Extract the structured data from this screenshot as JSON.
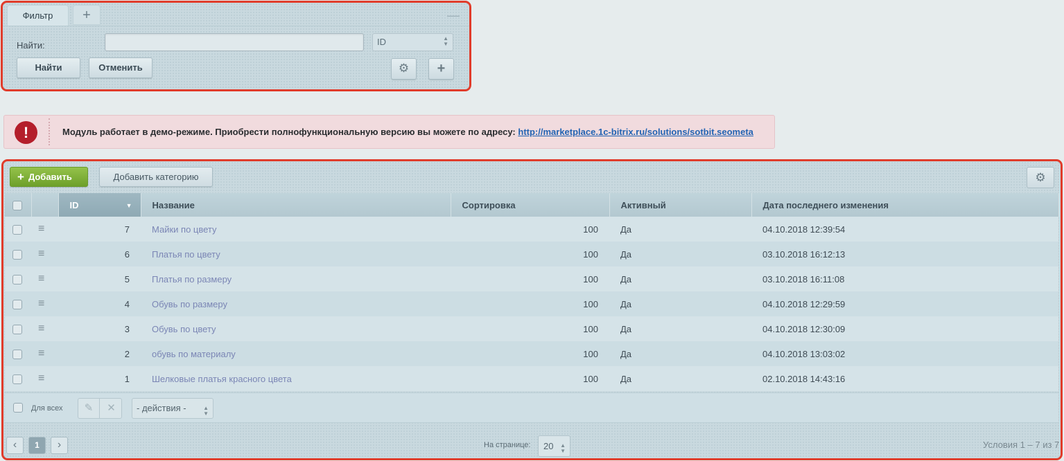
{
  "filter": {
    "tab_label": "Фильтр",
    "add_tab_icon": "plus-icon",
    "find_label": "Найти:",
    "search_value": "",
    "field_select": "ID",
    "find_button": "Найти",
    "cancel_button": "Отменить"
  },
  "notice": {
    "icon": "!",
    "text": "Модуль работает в демо-режиме. Приобрести полнофункциональную версию вы можете по адресу: ",
    "link": "http://marketplace.1c-bitrix.ru/solutions/sotbit.seometa"
  },
  "grid": {
    "add_button": "Добавить",
    "add_category_button": "Добавить категорию",
    "columns": [
      "ID",
      "Название",
      "Сортировка",
      "Активный",
      "Дата последнего изменения"
    ],
    "rows": [
      {
        "id": "7",
        "name": "Майки по цвету",
        "sort": "100",
        "active": "Да",
        "date": "04.10.2018 12:39:54"
      },
      {
        "id": "6",
        "name": "Платья по цвету",
        "sort": "100",
        "active": "Да",
        "date": "03.10.2018 16:12:13"
      },
      {
        "id": "5",
        "name": "Платья по размеру",
        "sort": "100",
        "active": "Да",
        "date": "03.10.2018 16:11:08"
      },
      {
        "id": "4",
        "name": "Обувь по размеру",
        "sort": "100",
        "active": "Да",
        "date": "04.10.2018 12:29:59"
      },
      {
        "id": "3",
        "name": "Обувь по цвету",
        "sort": "100",
        "active": "Да",
        "date": "04.10.2018 12:30:09"
      },
      {
        "id": "2",
        "name": "обувь по материалу",
        "sort": "100",
        "active": "Да",
        "date": "04.10.2018 13:03:02"
      },
      {
        "id": "1",
        "name": "Шелковые платья красного цвета",
        "sort": "100",
        "active": "Да",
        "date": "02.10.2018 14:43:16"
      }
    ],
    "for_all_label": "Для всех",
    "actions_select": "- действия -",
    "current_page": "1",
    "per_page_label": "На странице:",
    "per_page_value": "20",
    "total": "Условия 1 – 7 из 7"
  },
  "colors": {
    "highlight": "#e03c2b",
    "add_button": "#7aad33",
    "notice_icon": "#b41e2b",
    "link": "#2364b3"
  }
}
